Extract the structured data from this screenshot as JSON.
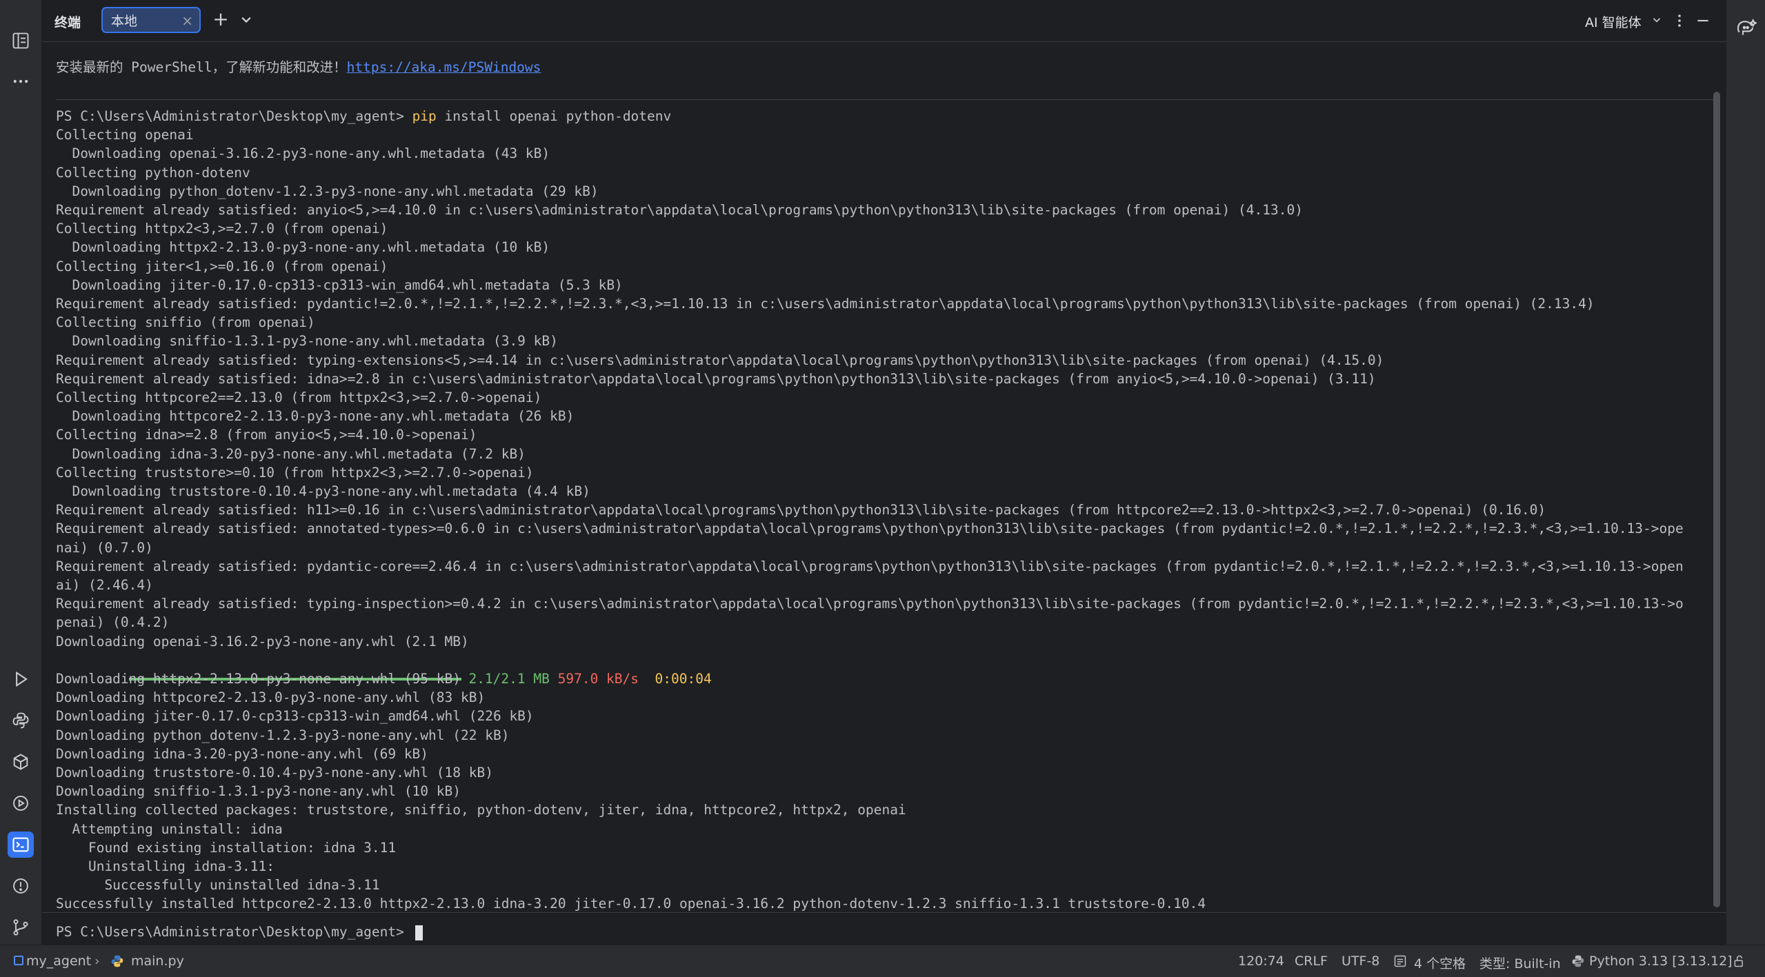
{
  "tabbar": {
    "title": "终端",
    "tab_label": "本地",
    "ai_label": "AI 智能体"
  },
  "terminal": {
    "hint_text": "安装最新的 PowerShell，了解新功能和改进！",
    "hint_link": "https://aka.ms/PSWindows",
    "prompt": "PS C:\\Users\\Administrator\\Desktop\\my_agent> ",
    "command_pip": "pip",
    "command_args": " install openai python-dotenv",
    "output_lines": [
      "Collecting openai",
      "  Downloading openai-3.16.2-py3-none-any.whl.metadata (43 kB)",
      "Collecting python-dotenv",
      "  Downloading python_dotenv-1.2.3-py3-none-any.whl.metadata (29 kB)",
      "Requirement already satisfied: anyio<5,>=4.10.0 in c:\\users\\administrator\\appdata\\local\\programs\\python\\python313\\lib\\site-packages (from openai) (4.13.0)",
      "Collecting httpx2<3,>=2.7.0 (from openai)",
      "  Downloading httpx2-2.13.0-py3-none-any.whl.metadata (10 kB)",
      "Collecting jiter<1,>=0.16.0 (from openai)",
      "  Downloading jiter-0.17.0-cp313-cp313-win_amd64.whl.metadata (5.3 kB)",
      "Requirement already satisfied: pydantic!=2.0.*,!=2.1.*,!=2.2.*,!=2.3.*,<3,>=1.10.13 in c:\\users\\administrator\\appdata\\local\\programs\\python\\python313\\lib\\site-packages (from openai) (2.13.4)",
      "Collecting sniffio (from openai)",
      "  Downloading sniffio-1.3.1-py3-none-any.whl.metadata (3.9 kB)",
      "Requirement already satisfied: typing-extensions<5,>=4.14 in c:\\users\\administrator\\appdata\\local\\programs\\python\\python313\\lib\\site-packages (from openai) (4.15.0)",
      "Requirement already satisfied: idna>=2.8 in c:\\users\\administrator\\appdata\\local\\programs\\python\\python313\\lib\\site-packages (from anyio<5,>=4.10.0->openai) (3.11)",
      "Collecting httpcore2==2.13.0 (from httpx2<3,>=2.7.0->openai)",
      "  Downloading httpcore2-2.13.0-py3-none-any.whl.metadata (26 kB)",
      "Collecting idna>=2.8 (from anyio<5,>=4.10.0->openai)",
      "  Downloading idna-3.20-py3-none-any.whl.metadata (7.2 kB)",
      "Collecting truststore>=0.10 (from httpx2<3,>=2.7.0->openai)",
      "  Downloading truststore-0.10.4-py3-none-any.whl.metadata (4.4 kB)",
      "Requirement already satisfied: h11>=0.16 in c:\\users\\administrator\\appdata\\local\\programs\\python\\python313\\lib\\site-packages (from httpcore2==2.13.0->httpx2<3,>=2.7.0->openai) (0.16.0)",
      "Requirement already satisfied: annotated-types>=0.6.0 in c:\\users\\administrator\\appdata\\local\\programs\\python\\python313\\lib\\site-packages (from pydantic!=2.0.*,!=2.1.*,!=2.2.*,!=2.3.*,<3,>=1.10.13->ope",
      "nai) (0.7.0)",
      "Requirement already satisfied: pydantic-core==2.46.4 in c:\\users\\administrator\\appdata\\local\\programs\\python\\python313\\lib\\site-packages (from pydantic!=2.0.*,!=2.1.*,!=2.2.*,!=2.3.*,<3,>=1.10.13->open",
      "ai) (2.46.4)",
      "Requirement already satisfied: typing-inspection>=0.4.2 in c:\\users\\administrator\\appdata\\local\\programs\\python\\python313\\lib\\site-packages (from pydantic!=2.0.*,!=2.1.*,!=2.2.*,!=2.3.*,<3,>=1.10.13->o",
      "penai) (0.4.2)",
      "Downloading openai-3.16.2-py3-none-any.whl (2.1 MB)"
    ],
    "progress": {
      "fraction": 1.0,
      "size_text": "2.1/2.1 MB",
      "speed_text": "597.0 kB/s",
      "eta_text": "0:00:04"
    },
    "output_lines_2": [
      "Downloading httpx2-2.13.0-py3-none-any.whl (95 kB)",
      "Downloading httpcore2-2.13.0-py3-none-any.whl (83 kB)",
      "Downloading jiter-0.17.0-cp313-cp313-win_amd64.whl (226 kB)",
      "Downloading python_dotenv-1.2.3-py3-none-any.whl (22 kB)",
      "Downloading idna-3.20-py3-none-any.whl (69 kB)",
      "Downloading truststore-0.10.4-py3-none-any.whl (18 kB)",
      "Downloading sniffio-1.3.1-py3-none-any.whl (10 kB)",
      "Installing collected packages: truststore, sniffio, python-dotenv, jiter, idna, httpcore2, httpx2, openai",
      "  Attempting uninstall: idna",
      "    Found existing installation: idna 3.11",
      "    Uninstalling idna-3.11:",
      "      Successfully uninstalled idna-3.11",
      "Successfully installed httpcore2-2.13.0 httpx2-2.13.0 idna-3.20 jiter-0.17.0 openai-3.16.2 python-dotenv-1.2.3 sniffio-1.3.1 truststore-0.10.4"
    ],
    "final_prompt": "PS C:\\Users\\Administrator\\Desktop\\my_agent> "
  },
  "statusbar": {
    "project": "my_agent",
    "file": "main.py",
    "position": "120:74",
    "line_ending": "CRLF",
    "encoding": "UTF-8",
    "indent": "4 个空格",
    "type": "类型: Built-in",
    "interpreter": "Python 3.13 [3.13.12]"
  },
  "colors": {
    "accent": "#3574f0",
    "command": "#f2c55c",
    "progress": "#6fbf73",
    "speed": "#f0685d",
    "link": "#548af7"
  },
  "icons": {
    "left": [
      "project-icon",
      "more-icon",
      "run-icon",
      "python-console-icon",
      "python-packages-icon",
      "services-icon",
      "terminal-icon",
      "problems-icon",
      "git-icon"
    ],
    "right": [
      "ai-assistant-icon"
    ]
  }
}
